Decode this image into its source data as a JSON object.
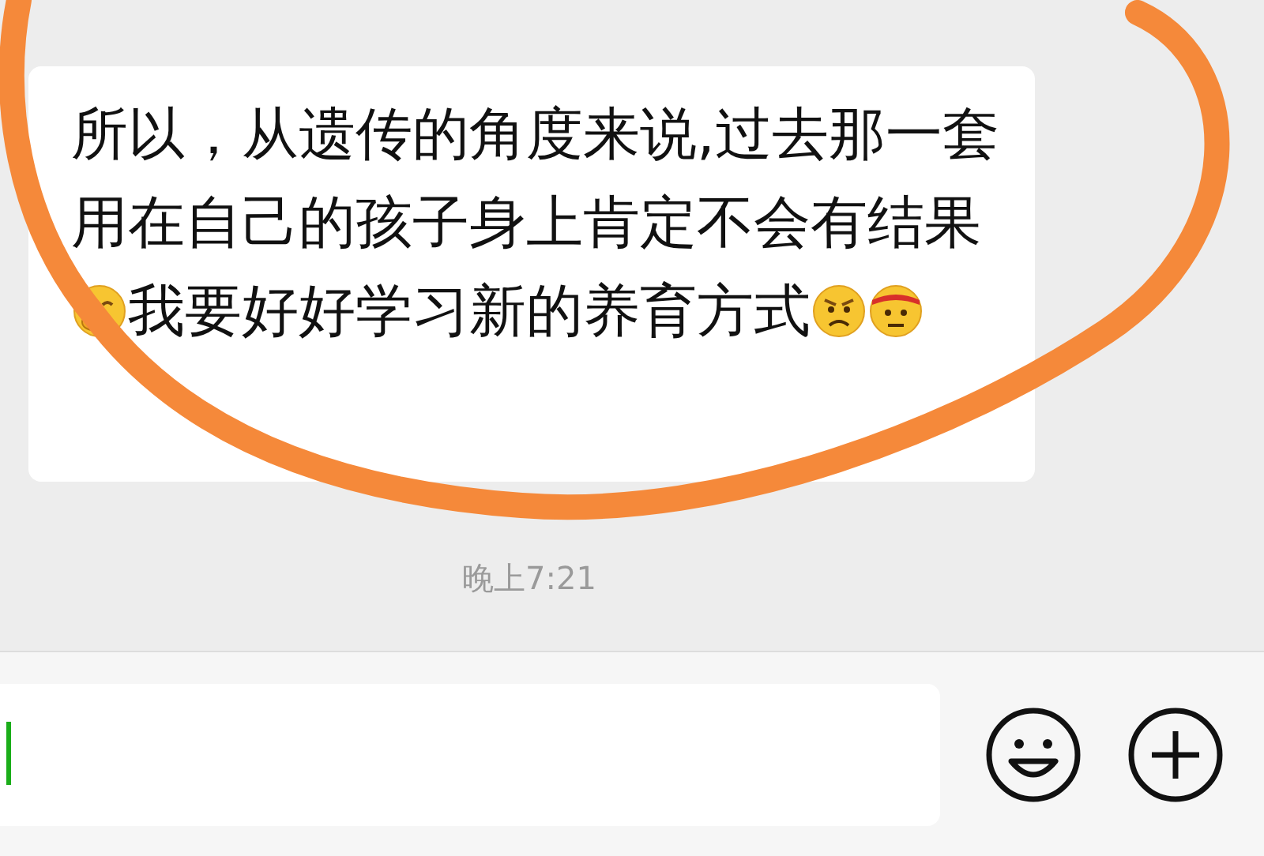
{
  "message": {
    "parts": [
      {
        "kind": "text",
        "text": "所以，从遗传的角度来说,过去那一套用在自己的孩子身上肯定不会有结果"
      },
      {
        "kind": "emoji"
      },
      {
        "kind": "text",
        "text": "我要好好学习新的养育方式"
      },
      {
        "kind": "emoji"
      },
      {
        "kind": "emoji"
      }
    ]
  },
  "timestamp": "晚上7:21"
}
